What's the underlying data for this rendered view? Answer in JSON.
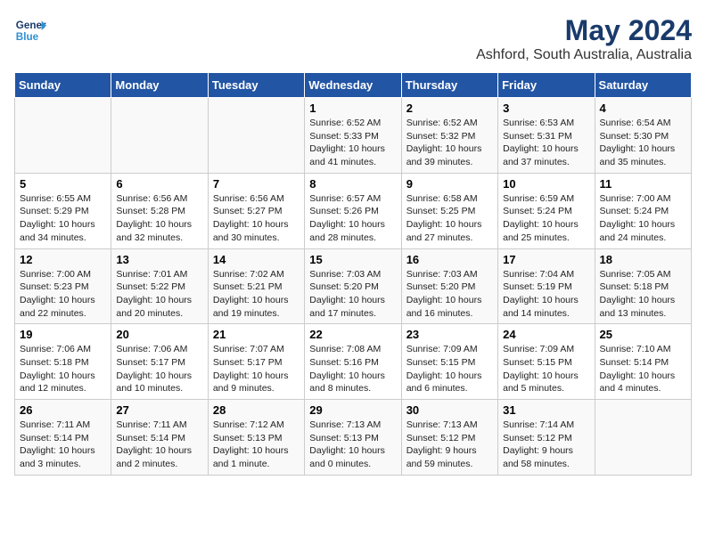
{
  "header": {
    "logo_line1": "General",
    "logo_line2": "Blue",
    "month_year": "May 2024",
    "location": "Ashford, South Australia, Australia"
  },
  "weekdays": [
    "Sunday",
    "Monday",
    "Tuesday",
    "Wednesday",
    "Thursday",
    "Friday",
    "Saturday"
  ],
  "weeks": [
    [
      {
        "day": "",
        "info": ""
      },
      {
        "day": "",
        "info": ""
      },
      {
        "day": "",
        "info": ""
      },
      {
        "day": "1",
        "info": "Sunrise: 6:52 AM\nSunset: 5:33 PM\nDaylight: 10 hours\nand 41 minutes."
      },
      {
        "day": "2",
        "info": "Sunrise: 6:52 AM\nSunset: 5:32 PM\nDaylight: 10 hours\nand 39 minutes."
      },
      {
        "day": "3",
        "info": "Sunrise: 6:53 AM\nSunset: 5:31 PM\nDaylight: 10 hours\nand 37 minutes."
      },
      {
        "day": "4",
        "info": "Sunrise: 6:54 AM\nSunset: 5:30 PM\nDaylight: 10 hours\nand 35 minutes."
      }
    ],
    [
      {
        "day": "5",
        "info": "Sunrise: 6:55 AM\nSunset: 5:29 PM\nDaylight: 10 hours\nand 34 minutes."
      },
      {
        "day": "6",
        "info": "Sunrise: 6:56 AM\nSunset: 5:28 PM\nDaylight: 10 hours\nand 32 minutes."
      },
      {
        "day": "7",
        "info": "Sunrise: 6:56 AM\nSunset: 5:27 PM\nDaylight: 10 hours\nand 30 minutes."
      },
      {
        "day": "8",
        "info": "Sunrise: 6:57 AM\nSunset: 5:26 PM\nDaylight: 10 hours\nand 28 minutes."
      },
      {
        "day": "9",
        "info": "Sunrise: 6:58 AM\nSunset: 5:25 PM\nDaylight: 10 hours\nand 27 minutes."
      },
      {
        "day": "10",
        "info": "Sunrise: 6:59 AM\nSunset: 5:24 PM\nDaylight: 10 hours\nand 25 minutes."
      },
      {
        "day": "11",
        "info": "Sunrise: 7:00 AM\nSunset: 5:24 PM\nDaylight: 10 hours\nand 24 minutes."
      }
    ],
    [
      {
        "day": "12",
        "info": "Sunrise: 7:00 AM\nSunset: 5:23 PM\nDaylight: 10 hours\nand 22 minutes."
      },
      {
        "day": "13",
        "info": "Sunrise: 7:01 AM\nSunset: 5:22 PM\nDaylight: 10 hours\nand 20 minutes."
      },
      {
        "day": "14",
        "info": "Sunrise: 7:02 AM\nSunset: 5:21 PM\nDaylight: 10 hours\nand 19 minutes."
      },
      {
        "day": "15",
        "info": "Sunrise: 7:03 AM\nSunset: 5:20 PM\nDaylight: 10 hours\nand 17 minutes."
      },
      {
        "day": "16",
        "info": "Sunrise: 7:03 AM\nSunset: 5:20 PM\nDaylight: 10 hours\nand 16 minutes."
      },
      {
        "day": "17",
        "info": "Sunrise: 7:04 AM\nSunset: 5:19 PM\nDaylight: 10 hours\nand 14 minutes."
      },
      {
        "day": "18",
        "info": "Sunrise: 7:05 AM\nSunset: 5:18 PM\nDaylight: 10 hours\nand 13 minutes."
      }
    ],
    [
      {
        "day": "19",
        "info": "Sunrise: 7:06 AM\nSunset: 5:18 PM\nDaylight: 10 hours\nand 12 minutes."
      },
      {
        "day": "20",
        "info": "Sunrise: 7:06 AM\nSunset: 5:17 PM\nDaylight: 10 hours\nand 10 minutes."
      },
      {
        "day": "21",
        "info": "Sunrise: 7:07 AM\nSunset: 5:17 PM\nDaylight: 10 hours\nand 9 minutes."
      },
      {
        "day": "22",
        "info": "Sunrise: 7:08 AM\nSunset: 5:16 PM\nDaylight: 10 hours\nand 8 minutes."
      },
      {
        "day": "23",
        "info": "Sunrise: 7:09 AM\nSunset: 5:15 PM\nDaylight: 10 hours\nand 6 minutes."
      },
      {
        "day": "24",
        "info": "Sunrise: 7:09 AM\nSunset: 5:15 PM\nDaylight: 10 hours\nand 5 minutes."
      },
      {
        "day": "25",
        "info": "Sunrise: 7:10 AM\nSunset: 5:14 PM\nDaylight: 10 hours\nand 4 minutes."
      }
    ],
    [
      {
        "day": "26",
        "info": "Sunrise: 7:11 AM\nSunset: 5:14 PM\nDaylight: 10 hours\nand 3 minutes."
      },
      {
        "day": "27",
        "info": "Sunrise: 7:11 AM\nSunset: 5:14 PM\nDaylight: 10 hours\nand 2 minutes."
      },
      {
        "day": "28",
        "info": "Sunrise: 7:12 AM\nSunset: 5:13 PM\nDaylight: 10 hours\nand 1 minute."
      },
      {
        "day": "29",
        "info": "Sunrise: 7:13 AM\nSunset: 5:13 PM\nDaylight: 10 hours\nand 0 minutes."
      },
      {
        "day": "30",
        "info": "Sunrise: 7:13 AM\nSunset: 5:12 PM\nDaylight: 9 hours\nand 59 minutes."
      },
      {
        "day": "31",
        "info": "Sunrise: 7:14 AM\nSunset: 5:12 PM\nDaylight: 9 hours\nand 58 minutes."
      },
      {
        "day": "",
        "info": ""
      }
    ]
  ]
}
